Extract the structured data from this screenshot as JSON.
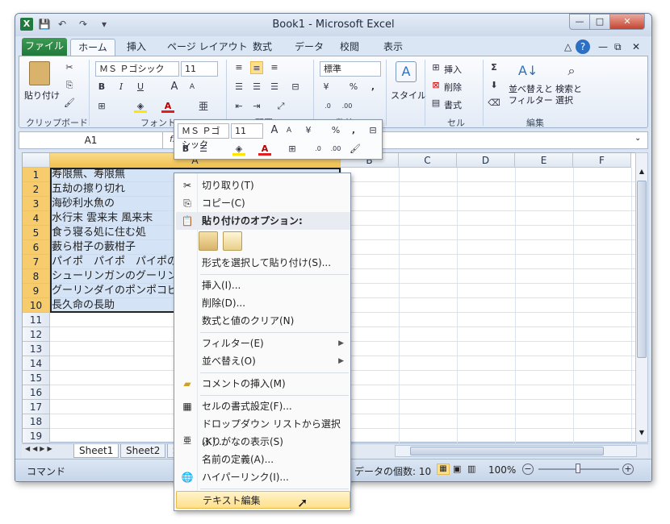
{
  "window": {
    "title": "Book1 - Microsoft Excel",
    "min": "—",
    "max": "□",
    "close": "✕"
  },
  "qat": {
    "app_icon": "X",
    "save": "💾",
    "undo": "↶",
    "redo": "↷",
    "more": "▾"
  },
  "tabs": [
    "ファイル",
    "ホーム",
    "挿入",
    "ページ レイアウト",
    "数式",
    "データ",
    "校閲",
    "表示"
  ],
  "tabbar_right": {
    "up": "△",
    "help": "?",
    "min": "—",
    "restore": "⧉",
    "close": "✕"
  },
  "ribbon": {
    "clipboard": {
      "paste": "貼り付け",
      "label": "クリップボード"
    },
    "font": {
      "name": "ＭＳ Ｐゴシック",
      "size": "11",
      "bold": "B",
      "italic": "I",
      "underline": "U",
      "grow": "A",
      "shrink": "A",
      "furigana": "亜",
      "label": "フォント"
    },
    "align": {
      "label": "配置"
    },
    "number": {
      "format": "標準",
      "percent": "%",
      "comma": ",",
      "label": "数値"
    },
    "styles": {
      "style": "スタイル"
    },
    "cells": {
      "insert": "挿入",
      "delete": "削除",
      "format": "書式",
      "label": "セル"
    },
    "editing": {
      "sigma": "Σ",
      "sort": "並べ替えと\nフィルター",
      "find": "検索と\n選択",
      "label": "編集"
    }
  },
  "formula_bar": {
    "name_box": "A1",
    "fx": "fx",
    "value": ""
  },
  "mini_toolbar": {
    "font": "ＭＳ Ｐゴシック",
    "size": "11",
    "bold": "B",
    "percent": "%",
    "comma": ","
  },
  "columns": [
    "A",
    "B",
    "C",
    "D",
    "E",
    "F"
  ],
  "rows": [
    "1",
    "2",
    "3",
    "4",
    "5",
    "6",
    "7",
    "8",
    "9",
    "10",
    "11",
    "12",
    "13",
    "14",
    "15",
    "16",
    "17",
    "18",
    "19"
  ],
  "cells": [
    "寿限無、寿限無",
    "五劫の擦り切れ",
    "海砂利水魚の",
    "水行末 雲来末 風来末",
    "食う寝る処に住む処",
    "藪ら柑子の藪柑子",
    "パイポ　パイポ　パイポのシューリンガン",
    "シューリンガンのグーリンダイ",
    "グーリンダイのポンポコピーのポンポコナーの",
    "長久命の長助"
  ],
  "sheets": [
    "Sheet1",
    "Sheet2",
    "S"
  ],
  "status": {
    "mode": "コマンド",
    "count_label": "データの個数: 10",
    "zoom": "100%"
  },
  "context_menu": {
    "cut": "切り取り(T)",
    "copy": "コピー(C)",
    "paste_options": "貼り付けのオプション:",
    "paste_special": "形式を選択して貼り付け(S)...",
    "insert": "挿入(I)...",
    "delete": "削除(D)...",
    "clear": "数式と値のクリア(N)",
    "filter": "フィルター(E)",
    "sort": "並べ替え(O)",
    "comment": "コメントの挿入(M)",
    "format_cells": "セルの書式設定(F)...",
    "dropdown": "ドロップダウン リストから選択(K)...",
    "furigana": "ふりがなの表示(S)",
    "define_name": "名前の定義(A)...",
    "hyperlink": "ハイパーリンク(I)...",
    "text_edit": "テキスト編集"
  }
}
